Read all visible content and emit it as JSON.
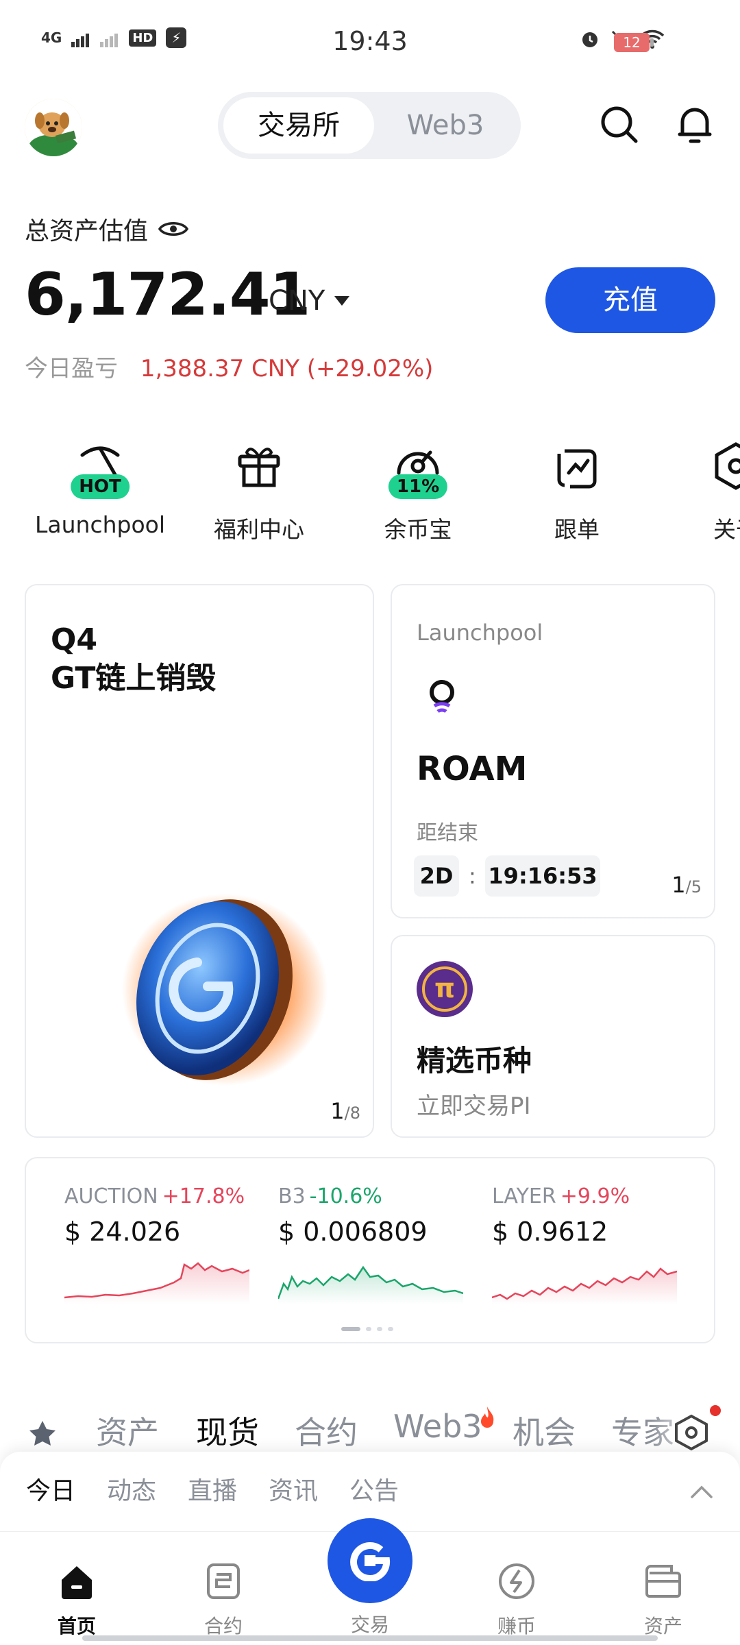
{
  "status_bar": {
    "network": "4G",
    "hd": "HD",
    "time": "19:43",
    "battery": "12"
  },
  "header": {
    "tabs": [
      "交易所",
      "Web3"
    ]
  },
  "assets": {
    "label": "总资产估值",
    "value": "6,172.41",
    "unit": "CNY",
    "deposit_label": "充值",
    "pnl_label": "今日盈亏",
    "pnl_value": "1,388.37 CNY  (+29.02%)"
  },
  "quick_actions": [
    {
      "label": "Launchpool",
      "badge": "HOT",
      "icon": "pickaxe-icon"
    },
    {
      "label": "福利中心",
      "badge": "",
      "icon": "gift-icon"
    },
    {
      "label": "余币宝",
      "badge": "11%",
      "icon": "savings-icon"
    },
    {
      "label": "跟单",
      "badge": "",
      "icon": "copy-trade-icon"
    },
    {
      "label": "关于",
      "badge": "",
      "icon": "about-icon"
    }
  ],
  "promo_card": {
    "title_line1": "Q4",
    "title_line2": "GT链上销毁",
    "page": "1",
    "total": "/8"
  },
  "launchpool_card": {
    "label": "Launchpool",
    "token": "ROAM",
    "ends_label": "距结束",
    "days": "2D",
    "sep": ":",
    "countdown": "19:16:53",
    "page": "1",
    "total": "/5"
  },
  "featured_card": {
    "logo": "π",
    "title": "精选币种",
    "subtitle": "立即交易PI"
  },
  "tickers": [
    {
      "symbol": "AUCTION",
      "change": "+17.8%",
      "price": "$ 24.026",
      "color": "#e5455b"
    },
    {
      "symbol": "B3",
      "change": "-10.6%",
      "price": "$ 0.006809",
      "color": "#1aa56b"
    },
    {
      "symbol": "LAYER",
      "change": "+9.9%",
      "price": "$ 0.9612",
      "color": "#e5455b"
    }
  ],
  "market_tabs": [
    "资产",
    "现货",
    "合约",
    "Web3",
    "机会",
    "专家"
  ],
  "feed_tabs": [
    "今日",
    "动态",
    "直播",
    "资讯",
    "公告"
  ],
  "bottom_nav": [
    "首页",
    "合约",
    "交易",
    "赚币",
    "资产"
  ],
  "colors": {
    "brand_blue": "#1f57e5",
    "up_red": "#e5455b",
    "down_green": "#1aa56b",
    "badge_green": "#1fd18f"
  }
}
